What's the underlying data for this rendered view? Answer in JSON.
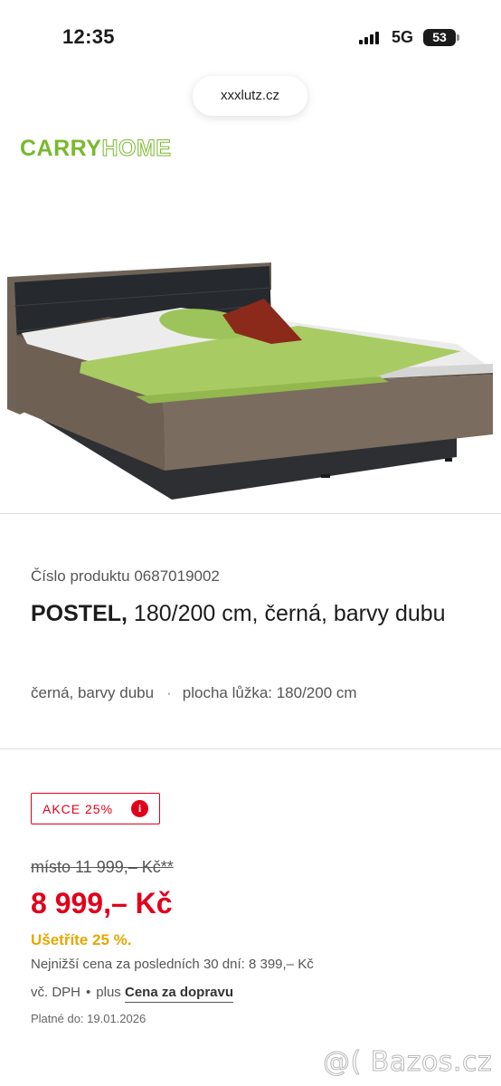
{
  "status_bar": {
    "time": "12:35",
    "network": "5G",
    "battery": "53"
  },
  "browser": {
    "url": "xxxlutz.cz"
  },
  "brand": {
    "logo_part1": "CARRY",
    "logo_part2": "HOME",
    "color": "#7ab82e"
  },
  "product": {
    "number_label": "Číslo produktu 0687019002",
    "title_bold": "POSTEL,",
    "title_rest": " 180/200 cm, černá, barvy dubu",
    "variant_color": "černá, barvy dubu",
    "variant_separator": "·",
    "variant_size": "plocha lůžka: 180/200 cm"
  },
  "pricing": {
    "promo_label": "AKCE 25%",
    "promo_info_icon": "i",
    "old_price": "místo 11 999,– Kč**",
    "current_price": "8 999,– Kč",
    "savings": "Ušetříte 25 %.",
    "lowest_price_note": "Nejnižší cena za posledních 30 dní: 8 399,– Kč",
    "vat": "vč. DPH",
    "separator": "•",
    "plus": "plus",
    "shipping_link": "Cena za dopravu",
    "valid_until": "Platné do: 19.01.2026",
    "accent_color": "#e1001a",
    "savings_color": "#e8a700"
  },
  "watermark": "@( Bazos.cz"
}
